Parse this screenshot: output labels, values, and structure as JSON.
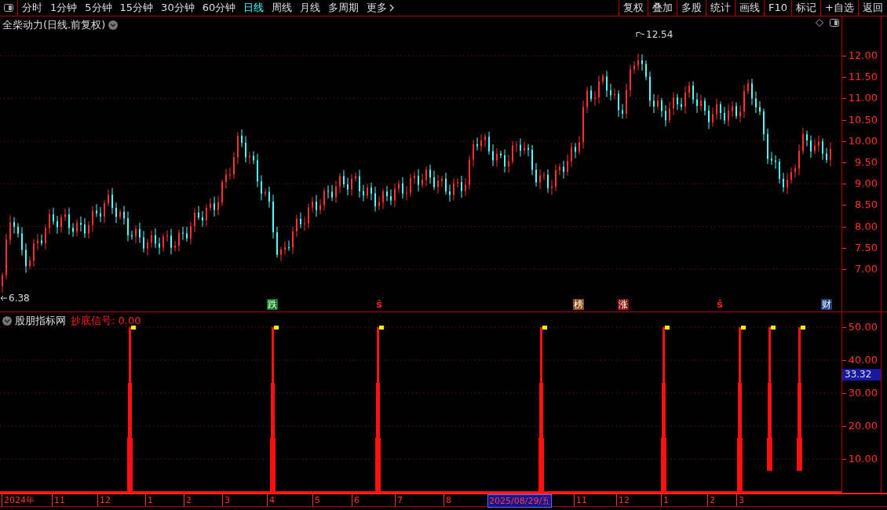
{
  "toolbar": {
    "periods": [
      {
        "label": "分时",
        "selected": false
      },
      {
        "label": "1分钟",
        "selected": false
      },
      {
        "label": "5分钟",
        "selected": false
      },
      {
        "label": "15分钟",
        "selected": false
      },
      {
        "label": "30分钟",
        "selected": false
      },
      {
        "label": "60分钟",
        "selected": false
      },
      {
        "label": "日线",
        "selected": true
      },
      {
        "label": "周线",
        "selected": false
      },
      {
        "label": "月线",
        "selected": false
      },
      {
        "label": "多周期",
        "selected": false
      },
      {
        "label": "更多",
        "selected": false
      }
    ],
    "actions": [
      "复权",
      "叠加",
      "多股",
      "统计",
      "画线",
      "F10",
      "标记",
      "+自选",
      "返回"
    ]
  },
  "price_panel": {
    "title": "全柴动力(日线.前复权)",
    "high_label": "12.54",
    "low_label": "6.38",
    "yticks": [
      "12.00",
      "11.50",
      "11.00",
      "10.50",
      "10.00",
      "9.50",
      "9.00",
      "8.50",
      "8.00",
      "7.50",
      "7.00"
    ],
    "tags": [
      {
        "text": "跌",
        "kind": "badge",
        "color": "#117a1f"
      },
      {
        "text": "ŝ",
        "kind": "symbol",
        "color": "#ff2020"
      },
      {
        "text": "榜",
        "kind": "badge",
        "color": "#8a4a12"
      },
      {
        "text": "涨",
        "kind": "badge",
        "color": "#8a1010"
      },
      {
        "text": "ŝ",
        "kind": "symbol",
        "color": "#ff2020"
      },
      {
        "text": "财",
        "kind": "badge",
        "color": "#1a3f7a"
      }
    ]
  },
  "indicator_panel": {
    "title": "股朋指标网",
    "signal": "抄底信号: 0.00",
    "yticks": [
      "50.00",
      "40.00",
      "30.00",
      "20.00",
      "10.00"
    ],
    "current_value": "33.32"
  },
  "time_axis": {
    "labels": [
      {
        "text": "2024年",
        "selected": false
      },
      {
        "text": "11",
        "selected": false
      },
      {
        "text": "12",
        "selected": false
      },
      {
        "text": "1",
        "selected": false
      },
      {
        "text": "2",
        "selected": false
      },
      {
        "text": "3",
        "selected": false
      },
      {
        "text": "4",
        "selected": false
      },
      {
        "text": "5",
        "selected": false
      },
      {
        "text": "6",
        "selected": false
      },
      {
        "text": "7",
        "selected": false
      },
      {
        "text": "8",
        "selected": false
      },
      {
        "text": "2025/08/29/五",
        "selected": true
      },
      {
        "text": "11",
        "selected": false
      },
      {
        "text": "12",
        "selected": false
      },
      {
        "text": "1",
        "selected": false
      },
      {
        "text": "2",
        "selected": false
      },
      {
        "text": "3",
        "selected": false
      }
    ]
  }
}
